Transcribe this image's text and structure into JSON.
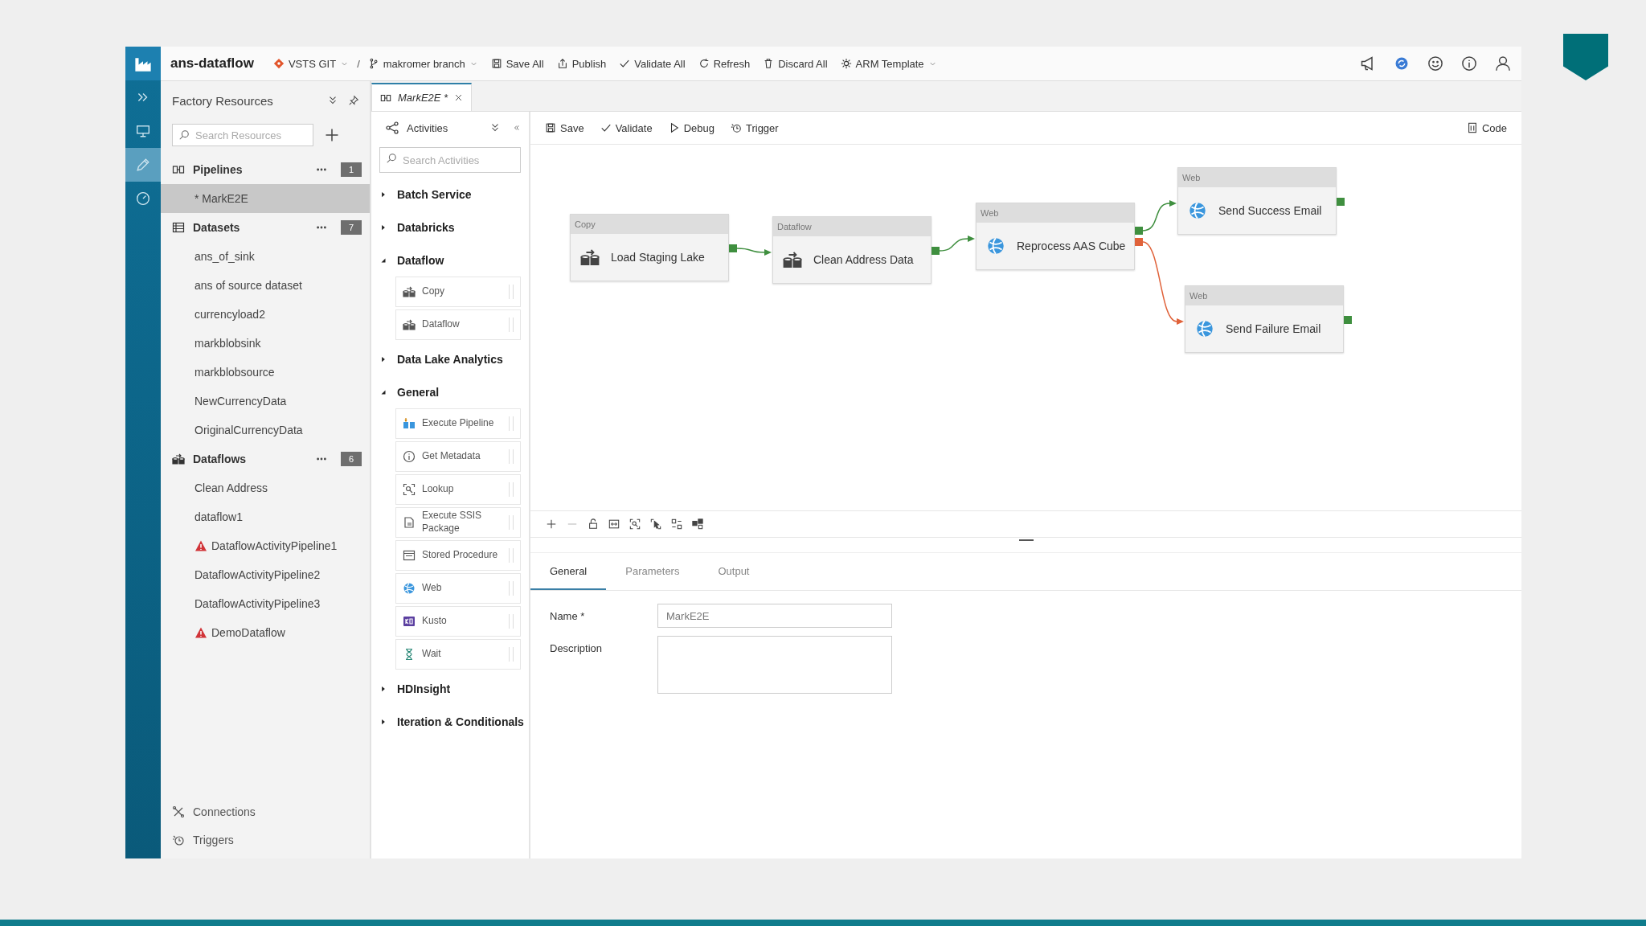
{
  "app": {
    "title": "ans-dataflow"
  },
  "toolbar": [
    {
      "label": "VSTS GIT",
      "kind": "git",
      "dropdown": true
    },
    {
      "label": "/",
      "kind": "separator"
    },
    {
      "label": "makromer branch",
      "kind": "branch",
      "dropdown": true
    },
    {
      "label": "Save All",
      "kind": "save",
      "dropdown": false
    },
    {
      "label": "Publish",
      "kind": "publish",
      "dropdown": false
    },
    {
      "label": "Validate All",
      "kind": "validate",
      "dropdown": false
    },
    {
      "label": "Refresh",
      "kind": "refresh",
      "dropdown": false
    },
    {
      "label": "Discard All",
      "kind": "discard",
      "dropdown": false
    },
    {
      "label": "ARM Template",
      "kind": "arm",
      "dropdown": true
    }
  ],
  "rail": [
    {
      "kind": "overview",
      "selected": false
    },
    {
      "kind": "author",
      "selected": true
    },
    {
      "kind": "monitor",
      "selected": false
    }
  ],
  "resources": {
    "title": "Factory Resources",
    "search_placeholder": "Search Resources",
    "groups": [
      {
        "label": "Pipelines",
        "kind": "pipeline",
        "count": "1",
        "items": [
          {
            "label": "* MarkE2E",
            "selected": true,
            "warning": false
          }
        ]
      },
      {
        "label": "Datasets",
        "kind": "dataset",
        "count": "7",
        "items": [
          {
            "label": "ans_of_sink",
            "selected": false,
            "warning": false
          },
          {
            "label": "ans of source dataset",
            "selected": false,
            "warning": false
          },
          {
            "label": "currencyload2",
            "selected": false,
            "warning": false
          },
          {
            "label": "markblobsink",
            "selected": false,
            "warning": false
          },
          {
            "label": "markblobsource",
            "selected": false,
            "warning": false
          },
          {
            "label": "NewCurrencyData",
            "selected": false,
            "warning": false
          },
          {
            "label": "OriginalCurrencyData",
            "selected": false,
            "warning": false
          }
        ]
      },
      {
        "label": "Dataflows",
        "kind": "dataflow",
        "count": "6",
        "items": [
          {
            "label": "Clean Address",
            "selected": false,
            "warning": false
          },
          {
            "label": "dataflow1",
            "selected": false,
            "warning": false
          },
          {
            "label": "DataflowActivityPipeline1",
            "selected": false,
            "warning": true
          },
          {
            "label": "DataflowActivityPipeline2",
            "selected": false,
            "warning": false
          },
          {
            "label": "DataflowActivityPipeline3",
            "selected": false,
            "warning": false
          },
          {
            "label": "DemoDataflow",
            "selected": false,
            "warning": true
          }
        ]
      }
    ],
    "footer": [
      {
        "label": "Connections",
        "kind": "connections"
      },
      {
        "label": "Triggers",
        "kind": "triggers"
      }
    ]
  },
  "editor_tab": {
    "label": "MarkE2E *",
    "selected": true
  },
  "activities": {
    "title": "Activities",
    "search_placeholder": "Search Activities",
    "categories": [
      {
        "label": "Batch Service",
        "expanded": false
      },
      {
        "label": "Databricks",
        "expanded": false
      },
      {
        "label": "Dataflow",
        "expanded": true,
        "items": [
          {
            "label": "Copy",
            "kind": "copy"
          },
          {
            "label": "Dataflow",
            "kind": "dataflow"
          }
        ]
      },
      {
        "label": "Data Lake Analytics",
        "expanded": false
      },
      {
        "label": "General",
        "expanded": true,
        "items": [
          {
            "label": "Execute Pipeline",
            "kind": "execute"
          },
          {
            "label": "Get Metadata",
            "kind": "metadata"
          },
          {
            "label": "Lookup",
            "kind": "lookup"
          },
          {
            "label": "Execute SSIS Package",
            "kind": "ssis"
          },
          {
            "label": "Stored Procedure",
            "kind": "procedure"
          },
          {
            "label": "Web",
            "kind": "web"
          },
          {
            "label": "Kusto",
            "kind": "kusto"
          },
          {
            "label": "Wait",
            "kind": "wait"
          }
        ]
      },
      {
        "label": "HDInsight",
        "expanded": false
      },
      {
        "label": "Iteration & Conditionals",
        "expanded": false
      }
    ]
  },
  "canvas_toolbar": [
    {
      "label": "Save",
      "kind": "save"
    },
    {
      "label": "Validate",
      "kind": "validate"
    },
    {
      "label": "Debug",
      "kind": "debug"
    },
    {
      "label": "Trigger",
      "kind": "trigger"
    }
  ],
  "code_button": {
    "label": "Code"
  },
  "nodes": [
    {
      "type": "Copy",
      "name": "Load Staging Lake",
      "kind": "copy",
      "ports": [
        {
          "color": "#3f8f3f"
        }
      ]
    },
    {
      "type": "Dataflow",
      "name": "Clean Address Data",
      "kind": "dataflow",
      "ports": [
        {
          "color": "#3f8f3f"
        }
      ]
    },
    {
      "type": "Web",
      "name": "Reprocess AAS Cube",
      "kind": "web",
      "ports": [
        {
          "color": "#3f8f3f"
        },
        {
          "color": "#e0623a"
        }
      ]
    },
    {
      "type": "Web",
      "name": "Send Success Email",
      "kind": "web",
      "ports": [
        {
          "color": "#3f8f3f"
        }
      ]
    },
    {
      "type": "Web",
      "name": "Send Failure Email",
      "kind": "web",
      "ports": [
        {
          "color": "#3f8f3f"
        }
      ]
    }
  ],
  "edges": [
    {
      "color": "#3f8f3f"
    },
    {
      "color": "#3f8f3f"
    },
    {
      "color": "#3f8f3f"
    },
    {
      "color": "#e0623a"
    }
  ],
  "properties": {
    "tabs": [
      {
        "label": "General",
        "selected": true
      },
      {
        "label": "Parameters",
        "selected": false
      },
      {
        "label": "Output",
        "selected": false
      }
    ],
    "name_label": "Name *",
    "name_value": "MarkE2E",
    "description_label": "Description"
  }
}
